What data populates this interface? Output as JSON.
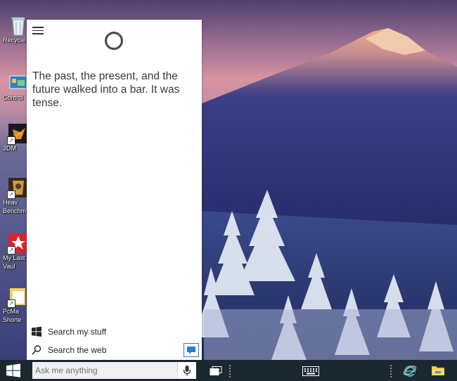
{
  "desktop": {
    "icons": [
      {
        "name": "recycle-bin",
        "label": "Recycle"
      },
      {
        "name": "control-panel",
        "label": "Control"
      },
      {
        "name": "3dmark",
        "label": "3DM"
      },
      {
        "name": "heaven-benchmark",
        "label": "Heav",
        "label2": "Benchm"
      },
      {
        "name": "my-last-vault",
        "label": "My Last",
        "label2": "Vaul"
      },
      {
        "name": "pcmark-shortcut",
        "label": "PcMa",
        "label2": "Shorte"
      }
    ]
  },
  "cortana": {
    "message": "The past, the present, and the future walked into a bar. It was tense.",
    "options": [
      {
        "label": "Search my stuff",
        "icon": "windows-logo-icon"
      },
      {
        "label": "Search the web",
        "icon": "search-icon"
      }
    ]
  },
  "taskbar": {
    "search_placeholder": "Ask me anything"
  },
  "colors": {
    "taskbar": "#1c2830",
    "accent": "#2b7bd8",
    "cortana_bg": "#ffffff"
  }
}
